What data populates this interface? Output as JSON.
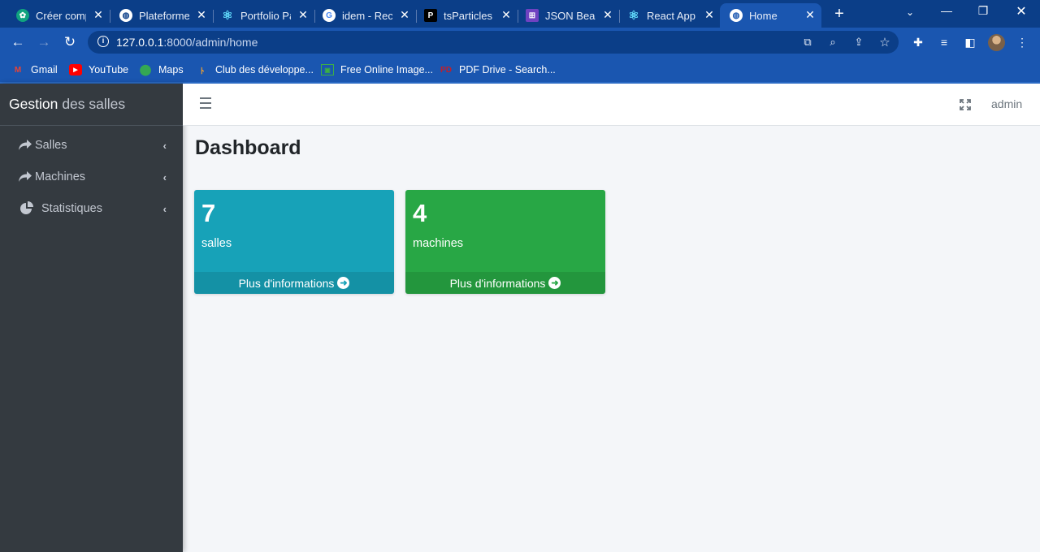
{
  "browser": {
    "tabs": [
      {
        "title": "Créer comp",
        "favicon": "chatgpt-icon",
        "color": "#10a37f"
      },
      {
        "title": "Plateforme",
        "favicon": "globe-icon",
        "color": "#ffffff"
      },
      {
        "title": "Portfolio Pa",
        "favicon": "react-icon",
        "color": "#61dafb"
      },
      {
        "title": "idem - Rech",
        "favicon": "google-icon",
        "color": "#ffffff"
      },
      {
        "title": "tsParticles |",
        "favicon": "tsparticles-icon",
        "color": "#000000"
      },
      {
        "title": "JSON Beauti",
        "favicon": "json-icon",
        "color": "#6f42c1"
      },
      {
        "title": "React App",
        "favicon": "react-icon",
        "color": "#61dafb"
      },
      {
        "title": "Home",
        "favicon": "globe-icon",
        "color": "#ffffff",
        "active": true
      }
    ],
    "url_host": "127.0.0.1",
    "url_rest": ":8000/admin/home",
    "bookmarks": [
      {
        "label": "Gmail",
        "icon": "gmail-icon"
      },
      {
        "label": "YouTube",
        "icon": "youtube-icon"
      },
      {
        "label": "Maps",
        "icon": "maps-icon"
      },
      {
        "label": "Club des développe...",
        "icon": "club-dev-icon"
      },
      {
        "label": "Free Online Image...",
        "icon": "image-icon"
      },
      {
        "label": "PDF Drive - Search...",
        "icon": "pdf-drive-icon"
      }
    ]
  },
  "sidebar": {
    "brand_bold": "Gestion",
    "brand_light": "des salles",
    "items": [
      {
        "label": "Salles",
        "icon": "share-icon"
      },
      {
        "label": "Machines",
        "icon": "share-icon"
      },
      {
        "label": "Statistiques",
        "icon": "pie-chart-icon"
      }
    ]
  },
  "topnav": {
    "user": "admin"
  },
  "page": {
    "title": "Dashboard"
  },
  "boxes": [
    {
      "value": "7",
      "label": "salles",
      "footer": "Plus d'informations",
      "color": "#17a2b8"
    },
    {
      "value": "4",
      "label": "machines",
      "footer": "Plus d'informations",
      "color": "#28a745"
    }
  ],
  "colors": {
    "sidebar_bg": "#343a40",
    "chrome_dark": "#0b3e88",
    "chrome_light": "#1a56b0",
    "content_bg": "#f4f6f9"
  }
}
